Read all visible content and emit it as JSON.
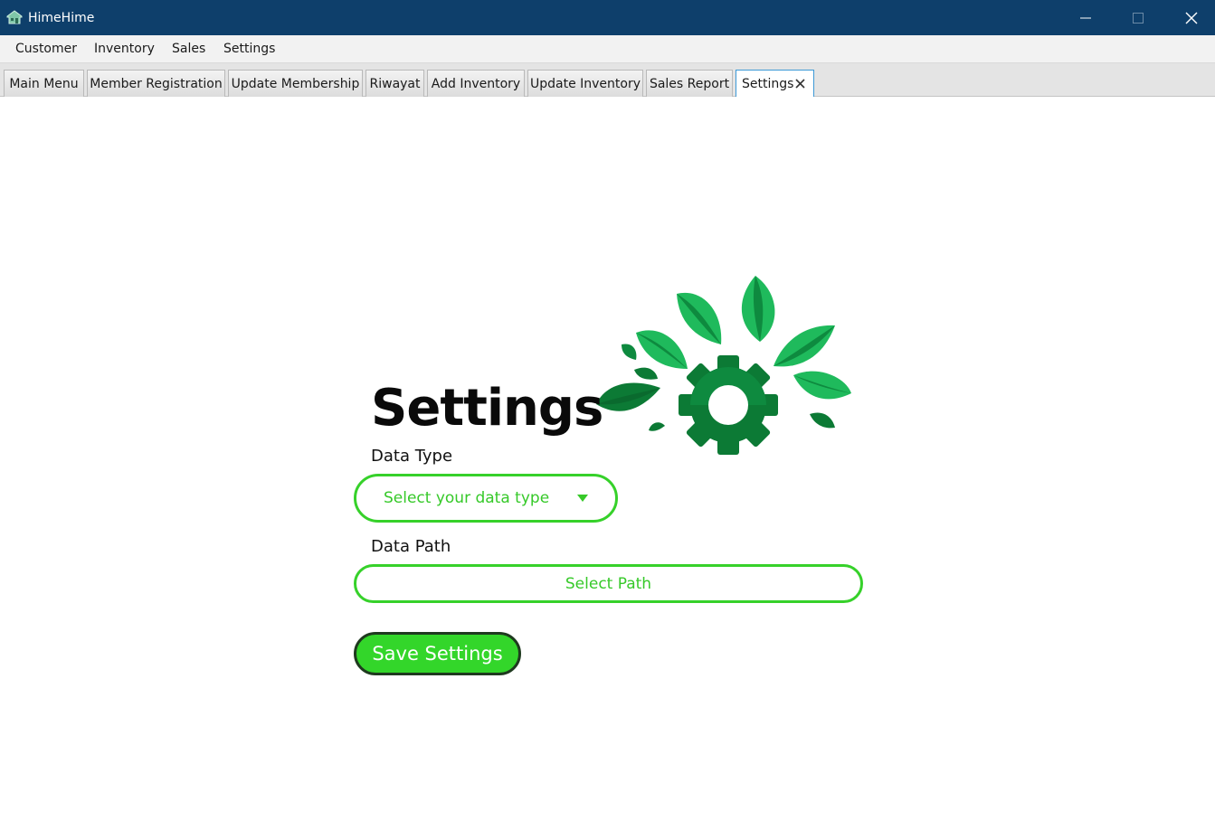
{
  "window": {
    "title": "HimeHime",
    "icon": "house-app-icon",
    "controls": [
      "minimize-icon",
      "maximize-icon",
      "close-icon"
    ]
  },
  "menu": {
    "items": [
      "Customer",
      "Inventory",
      "Sales",
      "Settings"
    ]
  },
  "tabs": {
    "items": [
      "Main Menu",
      "Member Registration",
      "Update Membership",
      "Riwayat",
      "Add Inventory",
      "Update Inventory",
      "Sales Report",
      "Settings"
    ],
    "active": "Settings"
  },
  "settings": {
    "title": "Settings",
    "data_type_label": "Data Type",
    "data_type_placeholder": "Select your data type",
    "data_path_label": "Data Path",
    "select_path_label": "Select Path",
    "save_label": "Save Settings"
  },
  "colors": {
    "titlebar": "#0e3f6b",
    "accent_green": "#36d12a",
    "leaf_dark": "#0c7a35",
    "leaf_light": "#1fba5c"
  }
}
